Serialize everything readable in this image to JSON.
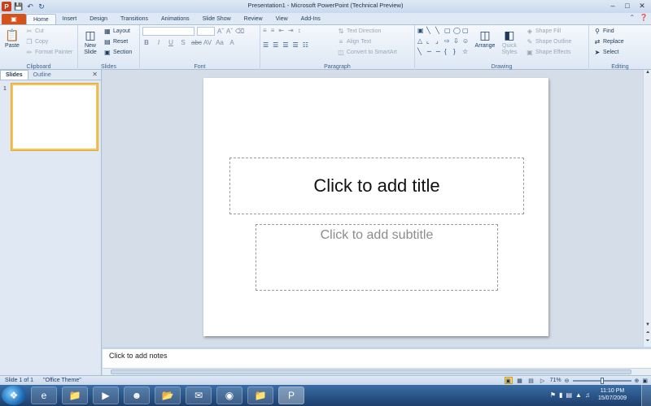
{
  "window": {
    "title": "Presentation1 - Microsoft PowerPoint (Technical Preview)",
    "app_icon": "P",
    "qat": [
      "save-icon",
      "undo-icon",
      "redo-icon"
    ],
    "controls": [
      "minimize-icon",
      "maximize-icon",
      "close-icon"
    ]
  },
  "ribbon_tabs": {
    "file": "",
    "tabs": [
      "Home",
      "Insert",
      "Design",
      "Transitions",
      "Animations",
      "Slide Show",
      "Review",
      "View",
      "Add-Ins"
    ],
    "active": "Home"
  },
  "ribbon": {
    "clipboard": {
      "label": "Clipboard",
      "paste": "Paste",
      "cut": "Cut",
      "copy": "Copy",
      "format_painter": "Format Painter"
    },
    "slides": {
      "label": "Slides",
      "new_slide": "New Slide",
      "layout": "Layout",
      "reset": "Reset",
      "section": "Section"
    },
    "font": {
      "label": "Font"
    },
    "paragraph": {
      "label": "Paragraph",
      "text_direction": "Text Direction",
      "align_text": "Align Text",
      "convert_smartart": "Convert to SmartArt"
    },
    "drawing": {
      "label": "Drawing",
      "arrange": "Arrange",
      "quick_styles": "Quick Styles",
      "shape_fill": "Shape Fill",
      "shape_outline": "Shape Outline",
      "shape_effects": "Shape Effects"
    },
    "editing": {
      "label": "Editing",
      "find": "Find",
      "replace": "Replace",
      "select": "Select"
    }
  },
  "pane": {
    "tabs": [
      "Slides",
      "Outline"
    ],
    "active": "Slides",
    "slide_number": "1"
  },
  "slide": {
    "title_placeholder": "Click to add title",
    "subtitle_placeholder": "Click to add subtitle"
  },
  "notes": {
    "placeholder": "Click to add notes"
  },
  "status": {
    "slide": "Slide 1 of 1",
    "theme": "\"Office Theme\"",
    "zoom": "71%"
  },
  "taskbar": {
    "apps": [
      "internet-explorer-icon",
      "folder-icon",
      "media-player-icon",
      "users-icon",
      "folder-icon",
      "outlook-icon",
      "browser-icon",
      "folder-icon",
      "powerpoint-icon"
    ],
    "time": "11:10 PM",
    "date": "15/07/2009"
  },
  "colors": {
    "file_tab": "#d4521c",
    "ribbon_bg": "#f5f8fc",
    "accent": "#f3c55a"
  }
}
